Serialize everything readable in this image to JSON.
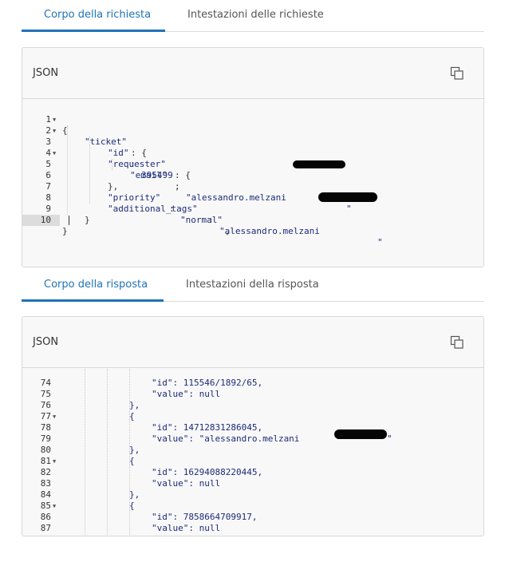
{
  "request_tabs": {
    "body_label": "Corpo della richiesta",
    "headers_label": "Intestazioni delle richieste"
  },
  "request_panel": {
    "title": "JSON",
    "lines": [
      {
        "n": "1",
        "fold": true
      },
      {
        "n": "2",
        "fold": true
      },
      {
        "n": "3",
        "fold": false
      },
      {
        "n": "4",
        "fold": true
      },
      {
        "n": "5",
        "fold": false
      },
      {
        "n": "6",
        "fold": false
      },
      {
        "n": "7",
        "fold": false
      },
      {
        "n": "8",
        "fold": false
      },
      {
        "n": "9",
        "fold": false
      },
      {
        "n": "10",
        "fold": false
      }
    ],
    "code": {
      "open": "{",
      "ticket_key": "\"ticket\"",
      "id_key": "\"id\"",
      "id_val": "395499",
      "requester_key": "\"requester\"",
      "email_key": "\"email\"",
      "email_val": "\"alessandro.melzani",
      "email_tail": "\"",
      "requester_close": "},",
      "priority_key": "\"priority\"",
      "priority_val": "\"normal\"",
      "tags_key": "\"additional_tags\"",
      "tags_val": "\"alessandro.melzani",
      "tags_tail": "\"",
      "ticket_close": "}",
      "close": "}"
    }
  },
  "response_tabs": {
    "body_label": "Corpo della risposta",
    "headers_label": "Intestazioni della risposta"
  },
  "response_panel": {
    "title": "JSON",
    "lines": [
      {
        "n": "74",
        "fold": false,
        "text": "\"id\": 115546/1892/65,"
      },
      {
        "n": "75",
        "fold": false,
        "text": "\"value\": null"
      },
      {
        "n": "76",
        "fold": false,
        "text": "},"
      },
      {
        "n": "77",
        "fold": true,
        "text": "{"
      },
      {
        "n": "78",
        "fold": false,
        "text": "\"id\": 14712831286045,"
      },
      {
        "n": "79",
        "fold": false,
        "text": "\"value\": \"alessandro.melzani"
      },
      {
        "n": "80",
        "fold": false,
        "text": "},"
      },
      {
        "n": "81",
        "fold": true,
        "text": "{"
      },
      {
        "n": "82",
        "fold": false,
        "text": "\"id\": 16294088220445,"
      },
      {
        "n": "83",
        "fold": false,
        "text": "\"value\": null"
      },
      {
        "n": "84",
        "fold": false,
        "text": "},"
      },
      {
        "n": "85",
        "fold": true,
        "text": "{"
      },
      {
        "n": "86",
        "fold": false,
        "text": "\"id\": 7858664709917,"
      },
      {
        "n": "87",
        "fold": false,
        "text": "\"value\": null"
      }
    ],
    "tail_79": "\""
  },
  "icons": {
    "copy": "copy-icon",
    "fold": "fold-arrow-icon"
  },
  "colors": {
    "accent": "#1f73b7",
    "code_text": "#1d2a7a",
    "panel_bg": "#f8f8f8",
    "border": "#d8d8d8"
  }
}
